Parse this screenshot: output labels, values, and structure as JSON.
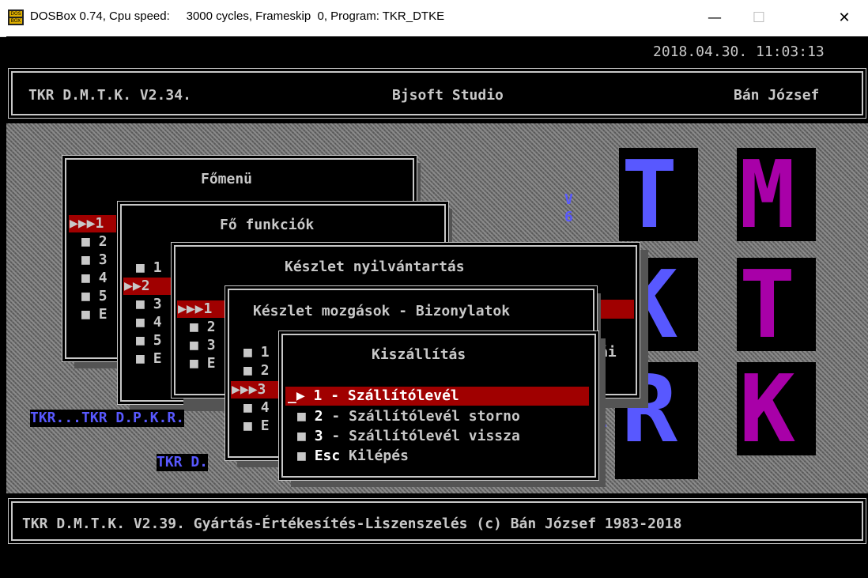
{
  "window": {
    "title": "DOSBox 0.74, Cpu speed:     3000 cycles, Frameskip  0, Program: TKR_DTKE",
    "minimize": "—",
    "maximize": "☐",
    "close": "✕"
  },
  "datetime": "2018.04.30. 11:03:13",
  "header": {
    "left": "TKR D.M.T.K. V2.34.",
    "center": "Bjsoft Studio",
    "right": "Bán József"
  },
  "logo": {
    "letters": [
      "T",
      "M",
      "K",
      "T",
      "R",
      "K"
    ],
    "version_v": "V",
    "version_n": "6"
  },
  "menu1": {
    "title": "Főmenü",
    "items": [
      "1",
      "2",
      "3",
      "4",
      "5",
      "E"
    ],
    "arrow": "▶▶▶"
  },
  "menu2": {
    "title": "Fő funkciók",
    "items": [
      "1",
      "2",
      "3",
      "4",
      "5",
      "E"
    ]
  },
  "menu3": {
    "title": "Készlet nyilvántartás",
    "items": [
      "1",
      "2",
      "3",
      "E"
    ],
    "partial": "ái"
  },
  "menu4": {
    "title": "Készlet mozgások - Bizonylatok",
    "items": [
      "1",
      "2",
      "3",
      "4",
      "E"
    ]
  },
  "menu5": {
    "title": "Kiszállítás",
    "items": [
      {
        "key": "1",
        "sep": "-",
        "label": "Szállítólevél"
      },
      {
        "key": "2",
        "sep": "-",
        "label": "Szállítólevél storno"
      },
      {
        "key": "3",
        "sep": "-",
        "label": "Szállítólevél vissza"
      },
      {
        "key": "Esc",
        "sep": "",
        "label": "Kilépés"
      }
    ]
  },
  "links": {
    "a": "TKR...TKR D.P.K.R.",
    "b": "TKR D.",
    "c": "."
  },
  "footer": "TKR D.M.T.K. V2.39. Gyártás-Értékesítés-Liszenszelés (c) Bán József 1983-2018",
  "colors": {
    "highlight": "#a00000",
    "logo_blue": "#5858ff",
    "logo_magenta": "#a800a8",
    "link_blue": "#5858ff"
  }
}
